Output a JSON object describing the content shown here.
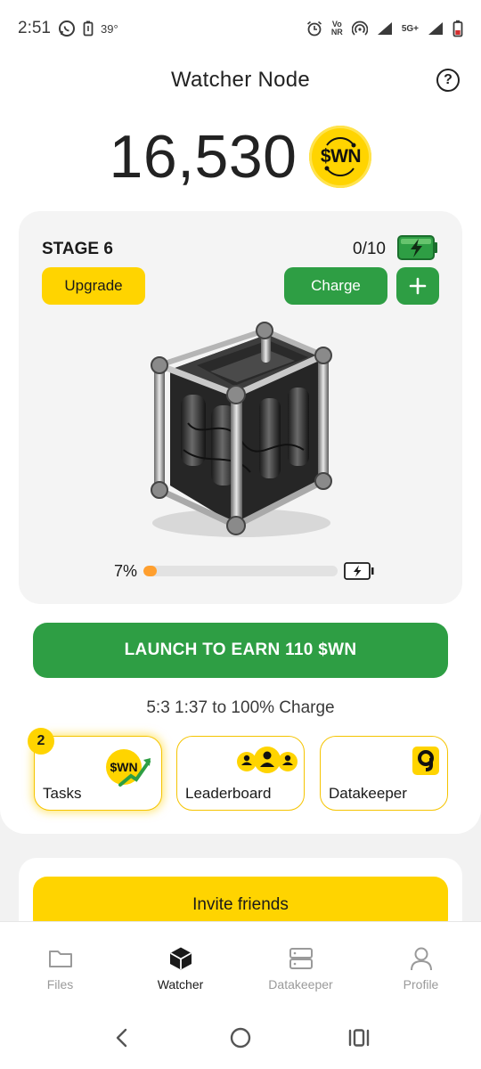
{
  "status_bar": {
    "time": "2:51",
    "temperature": "39°",
    "network_label": "5G+"
  },
  "header": {
    "title": "Watcher Node"
  },
  "balance": {
    "value": "16,530",
    "currency": "$WN"
  },
  "stage_card": {
    "stage_label": "STAGE 6",
    "energy": "0/10",
    "upgrade_label": "Upgrade",
    "charge_label": "Charge",
    "plus_label": "+",
    "progress_text": "7%",
    "progress_fraction": 0.07
  },
  "launch": {
    "label": "LAUNCH TO EARN 110 $WN"
  },
  "timer": {
    "text": "5:3 1:37 to 100% Charge"
  },
  "tiles": [
    {
      "label": "Tasks",
      "badge": "2",
      "icon_text": "$WN",
      "icon": "wn-coin-trend-icon"
    },
    {
      "label": "Leaderboard",
      "icon": "people-group-icon"
    },
    {
      "label": "Datakeeper",
      "icon": "datakeeper-icon"
    }
  ],
  "invite": {
    "label": "Invite friends"
  },
  "bottom_nav": [
    {
      "label": "Files",
      "icon": "folder-icon"
    },
    {
      "label": "Watcher",
      "icon": "cube-icon"
    },
    {
      "label": "Datakeeper",
      "icon": "server-icon"
    },
    {
      "label": "Profile",
      "icon": "user-icon"
    }
  ],
  "colors": {
    "brand_yellow": "#ffd400",
    "brand_green": "#2e9e44",
    "progress_orange": "#ff9f2e"
  }
}
